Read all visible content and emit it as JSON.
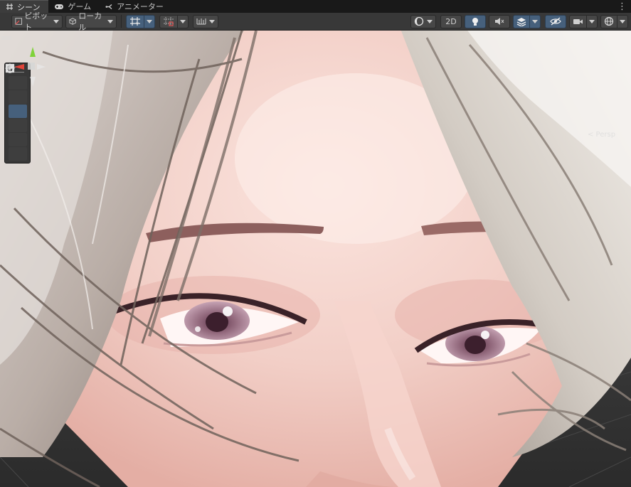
{
  "tabs": [
    {
      "label": "シーン",
      "icon": "hash-grid-icon",
      "active": true
    },
    {
      "label": "ゲーム",
      "icon": "gamepad-icon",
      "active": false
    },
    {
      "label": "アニメーター",
      "icon": "animator-icon",
      "active": false
    }
  ],
  "toolbar": {
    "pivot_label": "ピボット",
    "local_label": "ローカル",
    "mode_2d_label": "2D"
  },
  "scene": {
    "projection_label": "< Persp"
  },
  "tools": [
    "hand-tool",
    "move-tool",
    "rotate-tool",
    "scale-tool",
    "rect-tool",
    "transform-tool"
  ],
  "colors": {
    "accent": "#46607c",
    "toolbar": "#383838",
    "tabbar": "#191919",
    "skin": "#f2d3cc",
    "hair": "#d8d2cc",
    "iris": "#b48a9c"
  }
}
